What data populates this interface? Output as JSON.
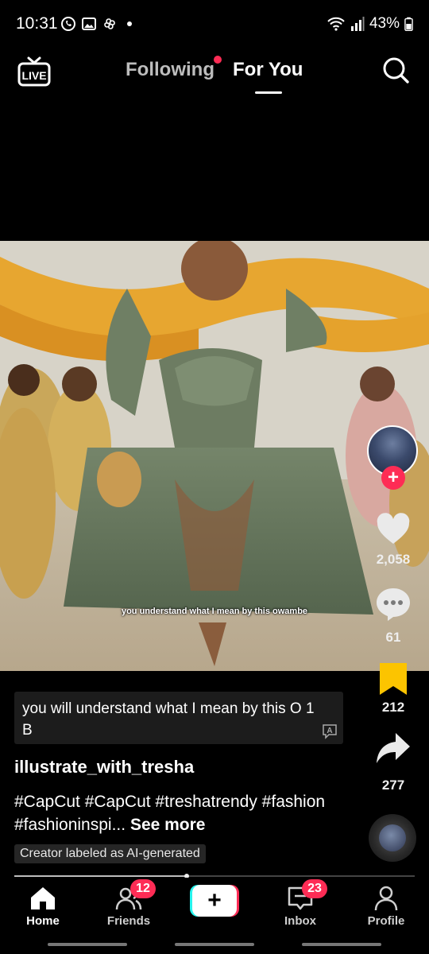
{
  "status_bar": {
    "time": "10:31",
    "battery": "43%"
  },
  "top_nav": {
    "live_label": "LIVE",
    "tab_following": "Following",
    "tab_for_you": "For You"
  },
  "video": {
    "burned_caption": "you understand what I mean by this owambe"
  },
  "actions": {
    "likes": "2,058",
    "comments": "61",
    "saves": "212",
    "shares": "277"
  },
  "post": {
    "translated_caption": "you will understand what I mean by this O 1 B",
    "author": "illustrate_with_tresha",
    "hashtags": "#CapCut #CapCut #treshatrendy #fashion #fashioninspi...",
    "see_more": "See more",
    "ai_label": "Creator labeled as AI-generated",
    "progress_fraction": 0.43
  },
  "bottom_nav": {
    "home": "Home",
    "friends": "Friends",
    "friends_badge": "12",
    "inbox": "Inbox",
    "inbox_badge": "23",
    "profile": "Profile"
  },
  "colors": {
    "accent_red": "#fe2c55",
    "accent_cyan": "#25f4ee",
    "save_yellow": "#fcc400"
  }
}
